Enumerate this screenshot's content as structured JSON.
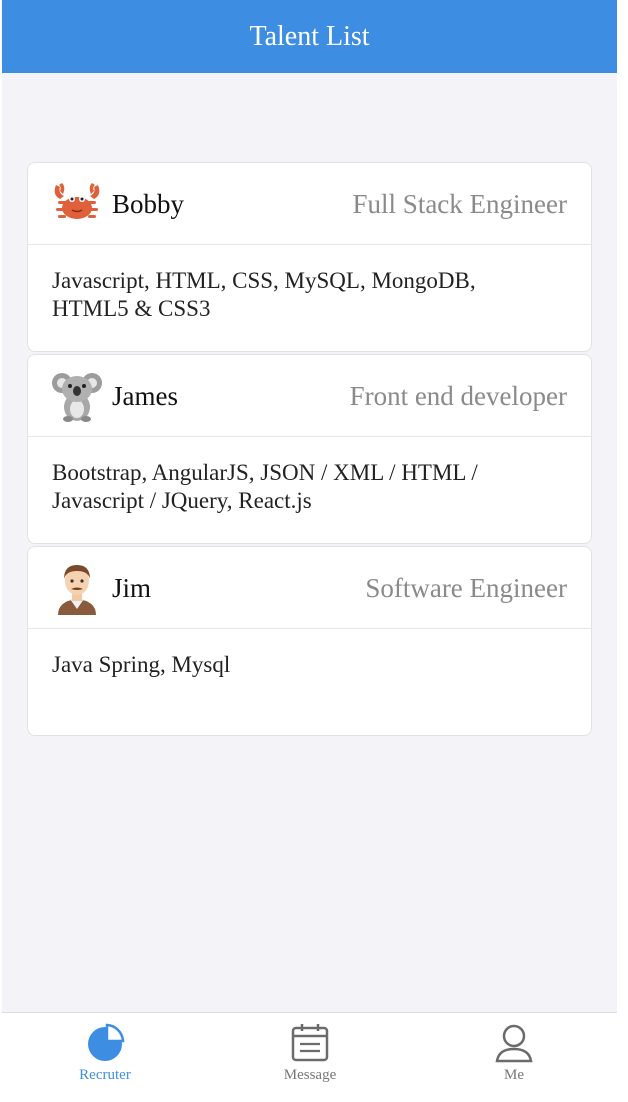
{
  "navbar": {
    "title": "Talent List"
  },
  "talents": [
    {
      "avatar_icon": "crab-icon",
      "name": "Bobby",
      "title": "Full Stack Engineer",
      "skills": "Javascript, HTML, CSS, MySQL, MongoDB, HTML5 & CSS3"
    },
    {
      "avatar_icon": "koala-icon",
      "name": "James",
      "title": "Front end developer",
      "skills": "Bootstrap, AngularJS, JSON / XML / HTML / Javascript / JQuery, React.js"
    },
    {
      "avatar_icon": "man-avatar-icon",
      "name": "Jim",
      "title": "Software Engineer",
      "skills": "Java Spring, Mysql"
    }
  ],
  "tabbar": {
    "items": [
      {
        "label": "Recruter",
        "icon": "pie-chart-icon",
        "active": true
      },
      {
        "label": "Message",
        "icon": "calendar-icon",
        "active": false
      },
      {
        "label": "Me",
        "icon": "user-icon",
        "active": false
      }
    ]
  },
  "colors": {
    "accent": "#3d8ee3",
    "background": "#f4f4f8",
    "muted_text": "#8a8a8a",
    "inactive_icon": "#6b6b6b"
  }
}
